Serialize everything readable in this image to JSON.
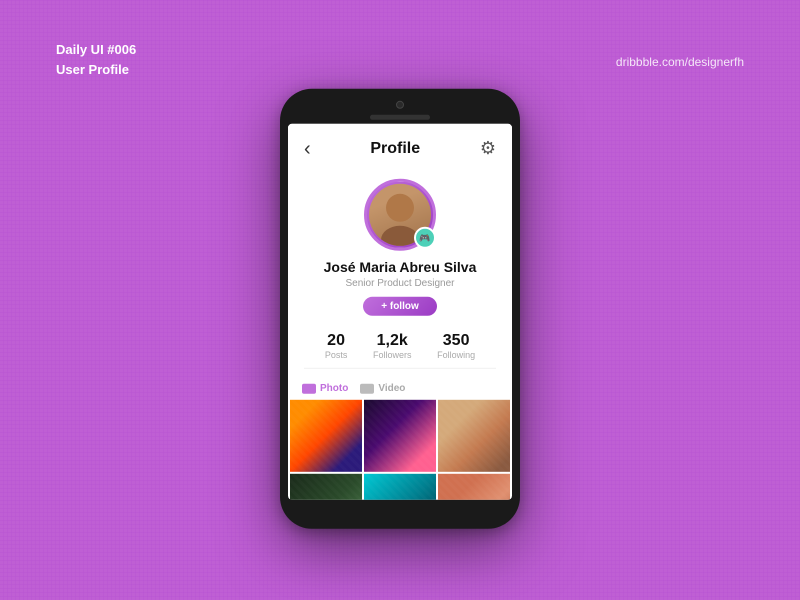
{
  "watermark": {
    "top_left_line1": "Daily UI #006",
    "top_left_line2": "User Profile",
    "top_right": "dribbble.com/designerfh"
  },
  "phone": {
    "header": {
      "back_label": "‹",
      "title": "Profile",
      "gear_label": "⚙"
    },
    "profile": {
      "name": "José Maria Abreu Silva",
      "role": "Senior Product Designer",
      "follow_label": "follow",
      "badge_icon": "🎮"
    },
    "stats": [
      {
        "value": "20",
        "label": "Posts"
      },
      {
        "value": "1,2k",
        "label": "Followers"
      },
      {
        "value": "350",
        "label": "Following"
      }
    ],
    "tabs": [
      {
        "label": "Photo",
        "active": true
      },
      {
        "label": "Video",
        "active": false
      }
    ],
    "photos": [
      {
        "id": 1
      },
      {
        "id": 2
      },
      {
        "id": 3
      },
      {
        "id": 4
      },
      {
        "id": 5
      },
      {
        "id": 6
      }
    ]
  },
  "colors": {
    "background": "#bf5fd4",
    "accent": "#c06fdc",
    "teal": "#4dd0b8"
  }
}
